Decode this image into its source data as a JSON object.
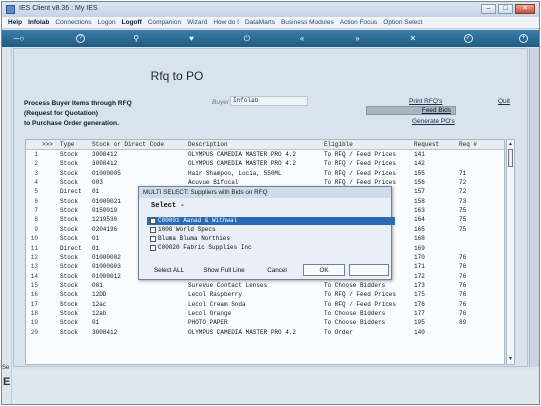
{
  "window": {
    "title": "IES Client v8.36 : My IES"
  },
  "menu": [
    "Help",
    "Infolab",
    "Connections",
    "Logon",
    "Logoff",
    "Companion",
    "Wizard",
    "How do I",
    "DataMarts",
    "Business Modules",
    "Action Focus",
    "Option Select"
  ],
  "toolbar_icons": [
    "key-icon",
    "help-icon",
    "search-icon",
    "heart-icon",
    "power-icon",
    "rewind-icon",
    "fast-forward-icon",
    "close-icon",
    "check-icon",
    "plus-icon"
  ],
  "page": {
    "title": "Rfq to PO",
    "description": [
      "Process Buyer Items through RFQ",
      "(Request for Quotation)",
      "to Purchase Order generation."
    ],
    "buyer_label": "Buyer",
    "buyer_value": "Infolab",
    "print_rfqs": "Print RFQ's",
    "feed_bids": "Feed Bids",
    "generate_pos": "Generate PO's",
    "quit": "Quit"
  },
  "grid": {
    "headers": {
      "marker": ">>>",
      "type": "Type",
      "code": "Stock or Direct Code",
      "description": "Description",
      "eligible": "Eligible",
      "request": "Request",
      "req": "Req #"
    },
    "rows": [
      {
        "n": "1",
        "type": "Stock",
        "code": "3008412",
        "description": "OLYMPUS CAMEDIA MASTER PRO 4.2",
        "eligible": "To RFQ / Feed Prices",
        "request": "141",
        "req": ""
      },
      {
        "n": "2",
        "type": "Stock",
        "code": "3008412",
        "description": "OLYMPUS CAMEDIA MASTER PRO 4.2",
        "eligible": "To RFQ / Feed Prices",
        "request": "142",
        "req": ""
      },
      {
        "n": "3",
        "type": "Stock",
        "code": "01000005",
        "description": "Hair Shampoo, Lucia, 550ML",
        "eligible": "To RFQ / Feed Prices",
        "request": "155",
        "req": "71"
      },
      {
        "n": "4",
        "type": "Stock",
        "code": "003",
        "description": "Acuvue Bifocal",
        "eligible": "To RFQ / Feed Prices",
        "request": "156",
        "req": "72"
      },
      {
        "n": "5",
        "type": "Direct",
        "code": "01",
        "description": "",
        "eligible": "",
        "request": "157",
        "req": "72"
      },
      {
        "n": "6",
        "type": "Stock",
        "code": "01000021",
        "description": "",
        "eligible": "",
        "request": "158",
        "req": "73"
      },
      {
        "n": "7",
        "type": "Stock",
        "code": "0150019",
        "description": "",
        "eligible": "",
        "request": "163",
        "req": "75"
      },
      {
        "n": "8",
        "type": "Stock",
        "code": "1219530",
        "description": "",
        "eligible": "",
        "request": "164",
        "req": "75"
      },
      {
        "n": "9",
        "type": "Stock",
        "code": "0204196",
        "description": "",
        "eligible": "",
        "request": "165",
        "req": "75"
      },
      {
        "n": "10",
        "type": "Stock",
        "code": "01",
        "description": "",
        "eligible": "",
        "request": "168",
        "req": ""
      },
      {
        "n": "11",
        "type": "Direct",
        "code": "01",
        "description": "",
        "eligible": "",
        "request": "169",
        "req": ""
      },
      {
        "n": "12",
        "type": "Stock",
        "code": "01000002",
        "description": "",
        "eligible": "",
        "request": "170",
        "req": "76"
      },
      {
        "n": "13",
        "type": "Stock",
        "code": "01000003",
        "description": "",
        "eligible": "",
        "request": "171",
        "req": "76"
      },
      {
        "n": "14",
        "type": "Stock",
        "code": "01000012",
        "description": "",
        "eligible": "",
        "request": "172",
        "req": "76"
      },
      {
        "n": "15",
        "type": "Stock",
        "code": "001",
        "description": "Surevue Contact Lenses",
        "eligible": "To Choose Bidders",
        "request": "173",
        "req": "76"
      },
      {
        "n": "16",
        "type": "Stock",
        "code": "12DD",
        "description": "Lecol Raspberry",
        "eligible": "To RFQ / Feed Prices",
        "request": "175",
        "req": "76"
      },
      {
        "n": "17",
        "type": "Stock",
        "code": "12ac",
        "description": "Lecol Cream Soda",
        "eligible": "To RFQ / Feed Prices",
        "request": "176",
        "req": "76"
      },
      {
        "n": "18",
        "type": "Stock",
        "code": "12ab",
        "description": "Lecol Orange",
        "eligible": "To Choose Bidders",
        "request": "177",
        "req": "76"
      },
      {
        "n": "19",
        "type": "Stock",
        "code": "01",
        "description": "PHOTO PAPER",
        "eligible": "To Choose Bidders",
        "request": "195",
        "req": "89"
      },
      {
        "n": "20",
        "type": "Stock",
        "code": "3008412",
        "description": "OLYMPUS CAMEDIA MASTER PRO 4.2",
        "eligible": "To Order",
        "request": "140",
        "req": ""
      }
    ]
  },
  "modal": {
    "title": "MULTI SELECT: Suppliers with Bids on RFQ",
    "heading": "Select -",
    "options": [
      {
        "label": "C00001 Aanad & Withwal",
        "selected": true
      },
      {
        "label": "1000 World Specs",
        "selected": false
      },
      {
        "label": "Bluma Bluma Northies",
        "selected": false
      },
      {
        "label": "C00020 Fabric Supplies Inc",
        "selected": false
      }
    ],
    "buttons": {
      "select_all": "Select ALL",
      "show_full_line": "Show Full Line",
      "cancel": "Cancel",
      "ok": "OK"
    }
  },
  "side": {
    "se_label": "Se"
  },
  "colors": {
    "toolbar": "#1f5a82",
    "selection": "#2b6ab6",
    "window_bg": "#d8e3ed"
  }
}
